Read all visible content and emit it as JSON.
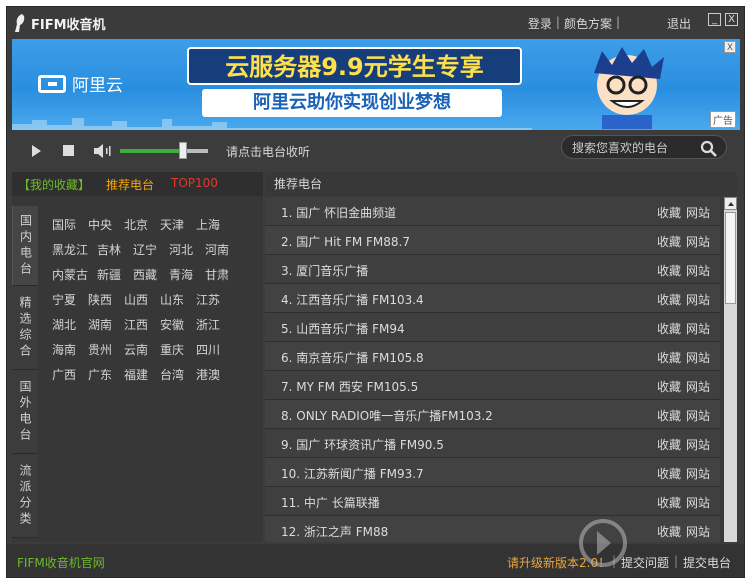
{
  "window": {
    "title": "FIFM收音机",
    "login": "登录",
    "color_scheme": "颜色方案",
    "exit": "退出",
    "minimize": "_",
    "close": "X"
  },
  "ad": {
    "brand": "阿里云",
    "headline": "云服务器9.9元学生专享",
    "subline": "阿里云助你实现创业梦想",
    "close": "X",
    "tag": "广告"
  },
  "player": {
    "status": "请点击电台收听",
    "volume": 0.72,
    "search_placeholder": "搜索您喜欢的电台"
  },
  "left": {
    "tabs": {
      "fav": "【我的收藏】",
      "recommend": "推荐电台",
      "top": "TOP100"
    },
    "vtabs": [
      "国内电台",
      "精选综合",
      "国外电台",
      "流派分类"
    ],
    "regions": [
      [
        "国际",
        "中央",
        "北京",
        "天津",
        "上海"
      ],
      [
        "黑龙江",
        "吉林",
        "辽宁",
        "河北",
        "河南"
      ],
      [
        "内蒙古",
        "新疆",
        "西藏",
        "青海",
        "甘肃"
      ],
      [
        "宁夏",
        "陕西",
        "山西",
        "山东",
        "江苏"
      ],
      [
        "湖北",
        "湖南",
        "江西",
        "安徽",
        "浙江"
      ],
      [
        "海南",
        "贵州",
        "云南",
        "重庆",
        "四川"
      ],
      [
        "广西",
        "广东",
        "福建",
        "台湾",
        "港澳"
      ]
    ]
  },
  "right": {
    "heading": "推荐电台",
    "fav_label": "收藏",
    "site_label": "网站",
    "stations": [
      "1. 国广 怀旧金曲频道",
      "2. 国广 Hit FM FM88.7",
      "3. 厦门音乐广播",
      "4. 江西音乐广播 FM103.4",
      "5. 山西音乐广播 FM94",
      "6. 南京音乐广播 FM105.8",
      "7. MY FM 西安 FM105.5",
      "8. ONLY RADIO唯一音乐广播FM103.2",
      "9. 国广 环球资讯广播 FM90.5",
      "10. 江苏新闻广播 FM93.7",
      "11. 中广 长篇联播",
      "12. 浙江之声 FM88"
    ]
  },
  "footer": {
    "official_site": "FIFM收音机官网",
    "upgrade": "请升级新版本2.0！",
    "feedback": "提交问题",
    "submit": "提交电台"
  },
  "colors": {
    "accent_green": "#3fae3f",
    "fav_green": "#6dbb2a",
    "recommend_orange": "#f4a500",
    "top_red": "#e03a2a",
    "upgrade_orange": "#e8a83a"
  }
}
